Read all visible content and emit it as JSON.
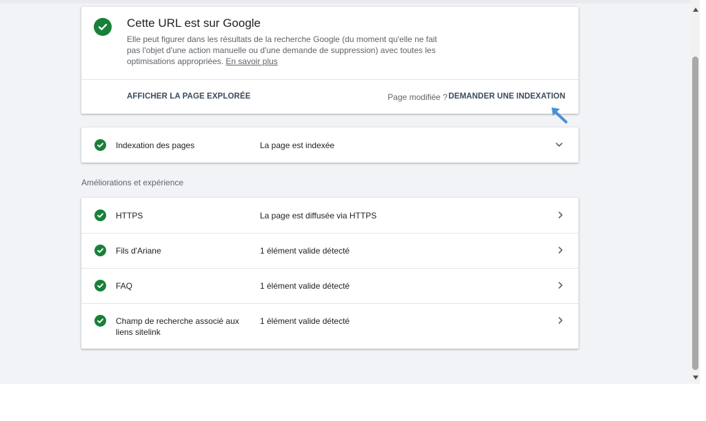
{
  "main_card": {
    "title": "Cette URL est sur Google",
    "description": "Elle peut figurer dans les résultats de la recherche Google (du moment qu'elle ne fait pas l'objet d'une action manuelle ou d'une demande de suppression) avec toutes les optimisations appropriées. ",
    "learn_more": "En savoir plus",
    "view_page_label": "AFFICHER LA PAGE EXPLORÉE",
    "page_modified_label": "Page modifiée ?",
    "request_indexing_label": "DEMANDER UNE INDEXATION"
  },
  "indexing": {
    "name": "Indexation des pages",
    "status": "La page est indexée"
  },
  "enhancements": {
    "section_title": "Améliorations et expérience",
    "rows": [
      {
        "name": "HTTPS",
        "status": "La page est diffusée via HTTPS"
      },
      {
        "name": "Fils d'Ariane",
        "status": "1 élément valide détecté"
      },
      {
        "name": "FAQ",
        "status": "1 élément valide détecté"
      },
      {
        "name": "Champ de recherche associé aux liens sitelink",
        "status": "1 élément valide détecté"
      }
    ]
  },
  "colors": {
    "success_green": "#188038",
    "arrow_blue": "#4a90d9",
    "page_background": "#f1f3f6"
  },
  "icons": [
    "check-circle-icon",
    "chevron-down-icon",
    "chevron-right-icon",
    "arrow-pointer-icon"
  ]
}
